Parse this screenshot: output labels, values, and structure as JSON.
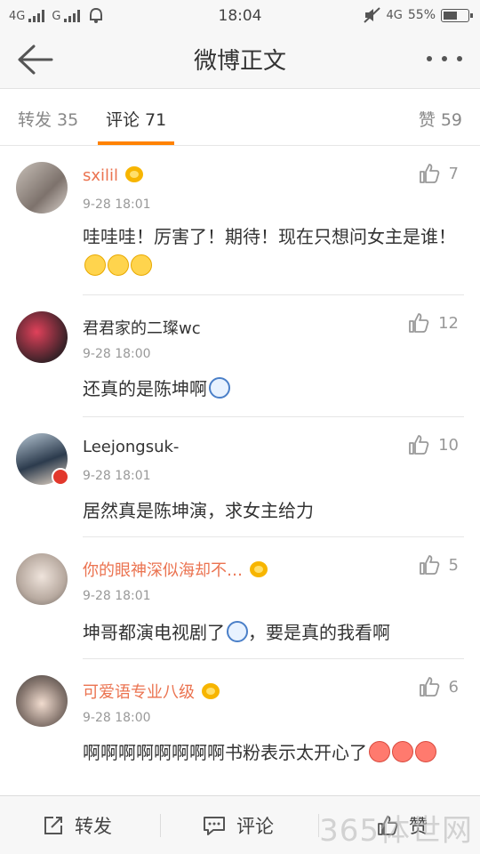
{
  "status_bar": {
    "net1": "4G",
    "net2": "G",
    "time": "18:04",
    "network": "4G",
    "battery": "55%"
  },
  "nav": {
    "title": "微博正文"
  },
  "tabs": {
    "repost": "转发 35",
    "comment": "评论 71",
    "like": "赞 59"
  },
  "comments": [
    {
      "user": "sxilil",
      "time": "9-28 18:01",
      "text": "哇哇哇！厉害了！期待！现在只想问女主是谁！",
      "likes": "7",
      "vip": true,
      "emoji": "smile-emoji"
    },
    {
      "user": "君君家的二璨wc",
      "time": "9-28 18:00",
      "text": "还真的是陈坤啊",
      "likes": "12",
      "vip": false,
      "emoji": "face-emoji"
    },
    {
      "user": "Leejongsuk-",
      "time": "9-28 18:01",
      "text": "居然真是陈坤演，求女主给力",
      "likes": "10",
      "vip": false
    },
    {
      "user": "你的眼神深似海却不…",
      "time": "9-28 18:01",
      "text_a": "坤哥都演电视剧了",
      "text_b": "，要是真的我看啊",
      "likes": "5",
      "vip": true,
      "emoji": "face-emoji"
    },
    {
      "user": "可爱语专业八级",
      "time": "9-28 18:00",
      "text": "啊啊啊啊啊啊啊啊书粉表示太开心了",
      "likes": "6",
      "vip": true,
      "emoji": "cry-emoji"
    }
  ],
  "bottom_bar": {
    "repost": "转发",
    "comment": "评论",
    "like": "赞"
  },
  "watermark": "365体世网",
  "colors": {
    "accent": "#ff8200",
    "vip_name": "#eb7350"
  }
}
